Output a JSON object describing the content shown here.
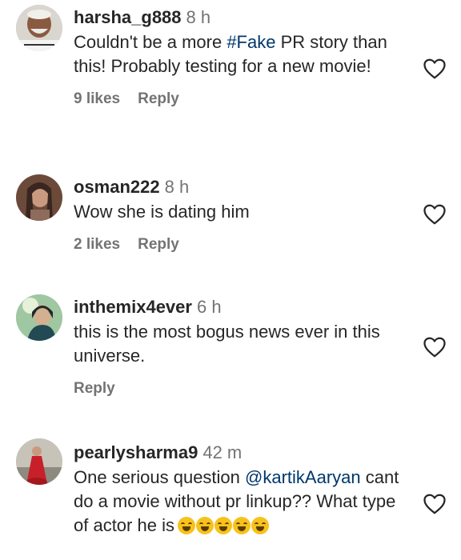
{
  "comments": [
    {
      "username": "harsha_g888",
      "time": "8 h",
      "text_before": "Couldn't be a more ",
      "hashtag": "#Fake",
      "text_after": " PR story than this! Probably testing for a new movie!",
      "likes": "9 likes",
      "reply": "Reply"
    },
    {
      "username": "osman222",
      "time": "8 h",
      "text": "Wow she is dating him",
      "likes": "2 likes",
      "reply": "Reply"
    },
    {
      "username": "inthemix4ever",
      "time": "6 h",
      "text": "this is the most bogus news ever in this universe.",
      "reply": "Reply"
    },
    {
      "username": "pearlysharma9",
      "time": "42 m",
      "text_before": "One serious question ",
      "mention": "@kartikAaryan",
      "text_after": " cant do a movie without pr linkup?? What type of actor he is",
      "emoji_name": "laughing-face-emoji"
    }
  ],
  "icons": {
    "heart": "heart-outline-icon"
  },
  "colors": {
    "username": "#262626",
    "meta": "#737373",
    "link": "#00376b"
  }
}
